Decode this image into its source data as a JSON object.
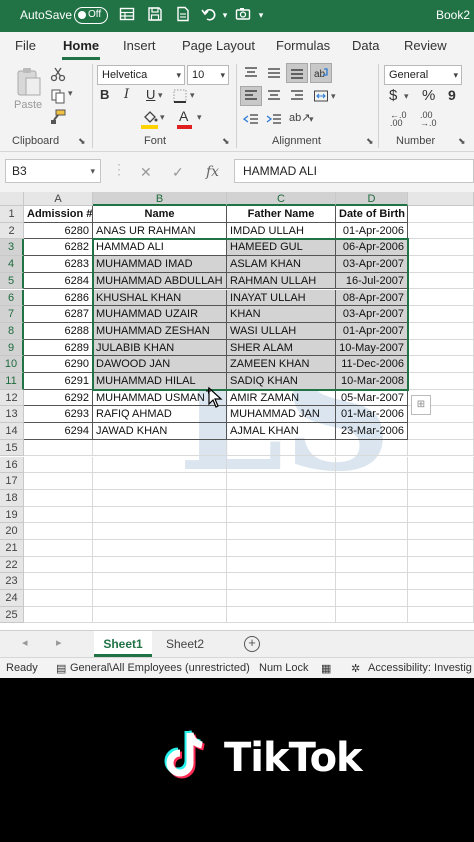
{
  "titlebar": {
    "autosave_label": "AutoSave",
    "toggle_state": "Off",
    "book_title": "Book2"
  },
  "ribbon_tabs": [
    "File",
    "Home",
    "Insert",
    "Page Layout",
    "Formulas",
    "Data",
    "Review"
  ],
  "active_tab": "Home",
  "ribbon": {
    "paste_label": "Paste",
    "font_name": "Helvetica",
    "font_size": "10",
    "number_format": "General",
    "groups": {
      "clipboard": "Clipboard",
      "font": "Font",
      "alignment": "Alignment",
      "number": "Number"
    },
    "bold": "B",
    "italic": "I",
    "underline": "U",
    "currency": "$",
    "percent": "%"
  },
  "formula_bar": {
    "name_box": "B3",
    "content": "HAMMAD ALI",
    "fx": "fx"
  },
  "columns": [
    "A",
    "B",
    "C",
    "D"
  ],
  "rows": [
    "1",
    "2",
    "3",
    "4",
    "5",
    "6",
    "7",
    "8",
    "9",
    "10",
    "11",
    "12",
    "13",
    "14",
    "15",
    "16",
    "17",
    "18",
    "19",
    "20",
    "21",
    "22",
    "23",
    "24",
    "25"
  ],
  "table": {
    "headers": [
      "Admission #",
      "Name",
      "Father Name",
      "Date of Birth"
    ],
    "records": [
      [
        "6280",
        "ANAS UR RAHMAN",
        "IMDAD ULLAH",
        "01-Apr-2006"
      ],
      [
        "6282",
        "HAMMAD ALI",
        "HAMEED GUL",
        "06-Apr-2006"
      ],
      [
        "6283",
        "MUHAMMAD IMAD",
        "ASLAM KHAN",
        "03-Apr-2007"
      ],
      [
        "6284",
        "MUHAMMAD ABDULLAH",
        "RAHMAN ULLAH",
        "16-Jul-2007"
      ],
      [
        "6286",
        "KHUSHAL KHAN",
        "INAYAT ULLAH",
        "08-Apr-2007"
      ],
      [
        "6287",
        "MUHAMMAD UZAIR",
        "KHAN",
        "03-Apr-2007"
      ],
      [
        "6288",
        "MUHAMMAD ZESHAN",
        "WASI ULLAH",
        "01-Apr-2007"
      ],
      [
        "6289",
        "JULABIB KHAN",
        "SHER ALAM",
        "10-May-2007"
      ],
      [
        "6290",
        " DAWOOD JAN",
        "ZAMEEN KHAN",
        "11-Dec-2006"
      ],
      [
        "6291",
        "MUHAMMAD HILAL",
        "SADIQ KHAN",
        "10-Mar-2008"
      ],
      [
        "6292",
        "MUHAMMAD USMAN",
        "AMIR ZAMAN",
        "05-Mar-2007"
      ],
      [
        "6293",
        "RAFIQ AHMAD",
        "MUHAMMAD JAN",
        "01-Mar-2006"
      ],
      [
        "6294",
        "JAWAD KHAN",
        "AJMAL KHAN",
        "23-Mar-2006"
      ]
    ]
  },
  "sheets": [
    "Sheet1",
    "Sheet2"
  ],
  "active_sheet": "Sheet1",
  "status": {
    "ready": "Ready",
    "sensitivity": "General\\All Employees (unrestricted)",
    "num_lock": "Num Lock",
    "accessibility": "Accessibility: Investig"
  },
  "overlay": {
    "brand": "TikTok"
  },
  "colors": {
    "excel_green": "#217346",
    "selection_fill": "#d3d3d3",
    "fill_yellow": "#ffd200",
    "font_red": "#e02020"
  }
}
